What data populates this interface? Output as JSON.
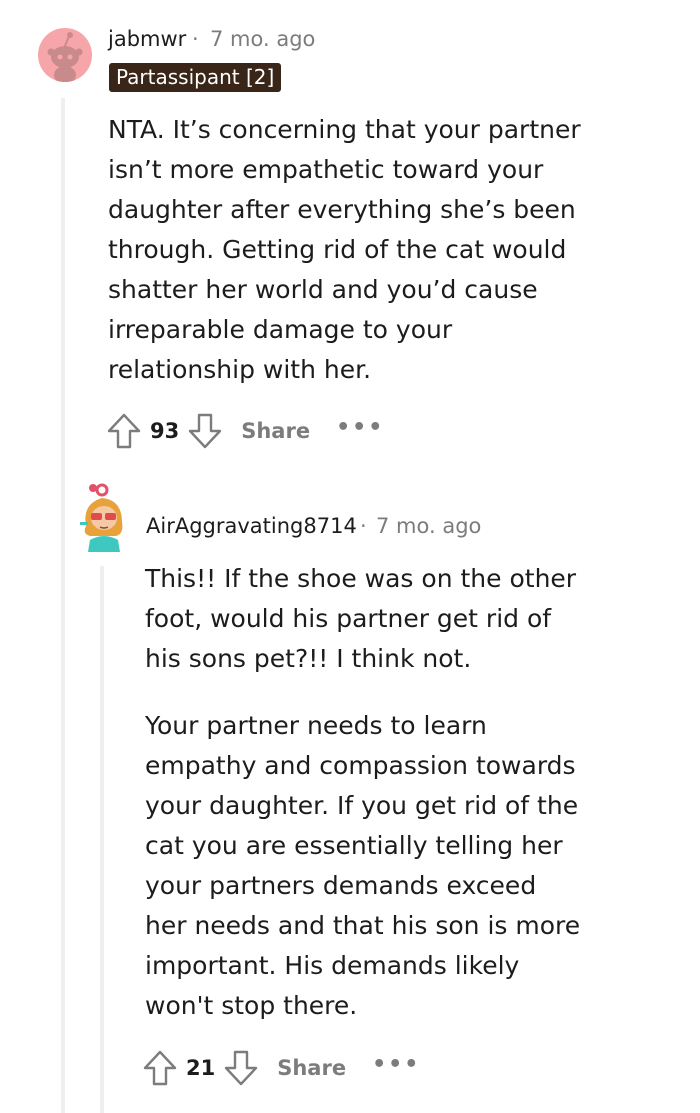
{
  "comments": [
    {
      "username": "jabmwr",
      "time": "7 mo. ago",
      "flair": "Partassipant [2]",
      "avatar_icon": "snoo-avatar-icon",
      "body": "NTA. It’s concerning that your partner\nisn’t more empathetic toward your\ndaughter after everything she’s been\nthrough. Getting rid of the cat would\nshatter her world and you’d cause\nirreparable damage to your\nrelationship with her.",
      "score": "93",
      "share_label": "Share",
      "more_label": "•••"
    },
    {
      "username": "AirAggravating8714",
      "time": "7 mo. ago",
      "avatar_icon": "cartoon-girl-avatar-icon",
      "body_p1": "This!! If the shoe was on the other\nfoot, would his partner get rid of\nhis sons pet?!! I think not.",
      "body_p2": "Your partner needs to learn\nempathy and compassion towards\nyour daughter. If you get rid of the\ncat you are essentially telling her\nyour partners demands exceed\nher needs and that his son is more\nimportant. His demands likely\nwon't stop there.",
      "score": "21",
      "share_label": "Share",
      "more_label": "•••"
    }
  ],
  "separator": "·",
  "colors": {
    "avatar_bg": "#f6a6a9",
    "flair_bg": "#3a2519",
    "meta_gray": "#7c7c7c",
    "thread_line": "#edeff1"
  }
}
